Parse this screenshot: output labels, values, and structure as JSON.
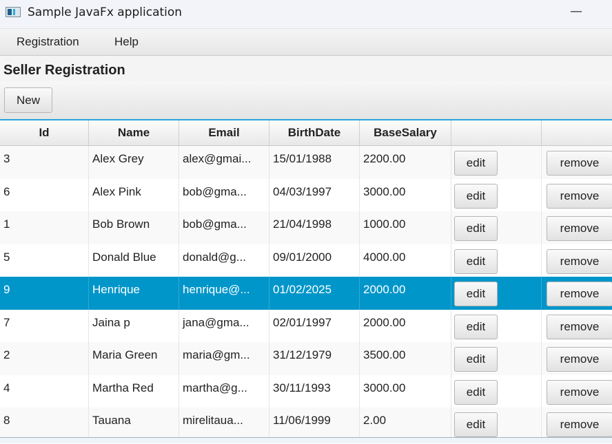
{
  "window": {
    "title": "Sample JavaFx application",
    "minimize_glyph": "—"
  },
  "menu": {
    "items": [
      "Registration",
      "Help"
    ]
  },
  "page": {
    "title": "Seller Registration",
    "new_button": "New"
  },
  "table": {
    "columns": [
      "Id",
      "Name",
      "Email",
      "BirthDate",
      "BaseSalary",
      "",
      ""
    ],
    "edit_label": "edit",
    "remove_label": "remove",
    "selected_row": 4,
    "rows": [
      {
        "id": "3",
        "name": "Alex Grey",
        "email": "alex@gmai...",
        "birth": "15/01/1988",
        "salary": "2200.00"
      },
      {
        "id": "6",
        "name": "Alex Pink",
        "email": "bob@gma...",
        "birth": "04/03/1997",
        "salary": "3000.00"
      },
      {
        "id": "1",
        "name": "Bob Brown",
        "email": "bob@gma...",
        "birth": "21/04/1998",
        "salary": "1000.00"
      },
      {
        "id": "5",
        "name": "Donald Blue",
        "email": "donald@g...",
        "birth": "09/01/2000",
        "salary": "4000.00"
      },
      {
        "id": "9",
        "name": "Henrique",
        "email": "henrique@...",
        "birth": "01/02/2025",
        "salary": "2000.00"
      },
      {
        "id": "7",
        "name": "Jaina p",
        "email": "jana@gma...",
        "birth": "02/01/1997",
        "salary": "2000.00"
      },
      {
        "id": "2",
        "name": "Maria Green",
        "email": "maria@gm...",
        "birth": "31/12/1979",
        "salary": "3500.00"
      },
      {
        "id": "4",
        "name": "Martha Red",
        "email": "martha@g...",
        "birth": "30/11/1993",
        "salary": "3000.00"
      },
      {
        "id": "8",
        "name": "Tauana",
        "email": "mirelitaua...",
        "birth": "11/06/1999",
        "salary": "2.00"
      }
    ]
  },
  "colors": {
    "selection": "#0096c9",
    "table_focus": "#29a3e0"
  }
}
